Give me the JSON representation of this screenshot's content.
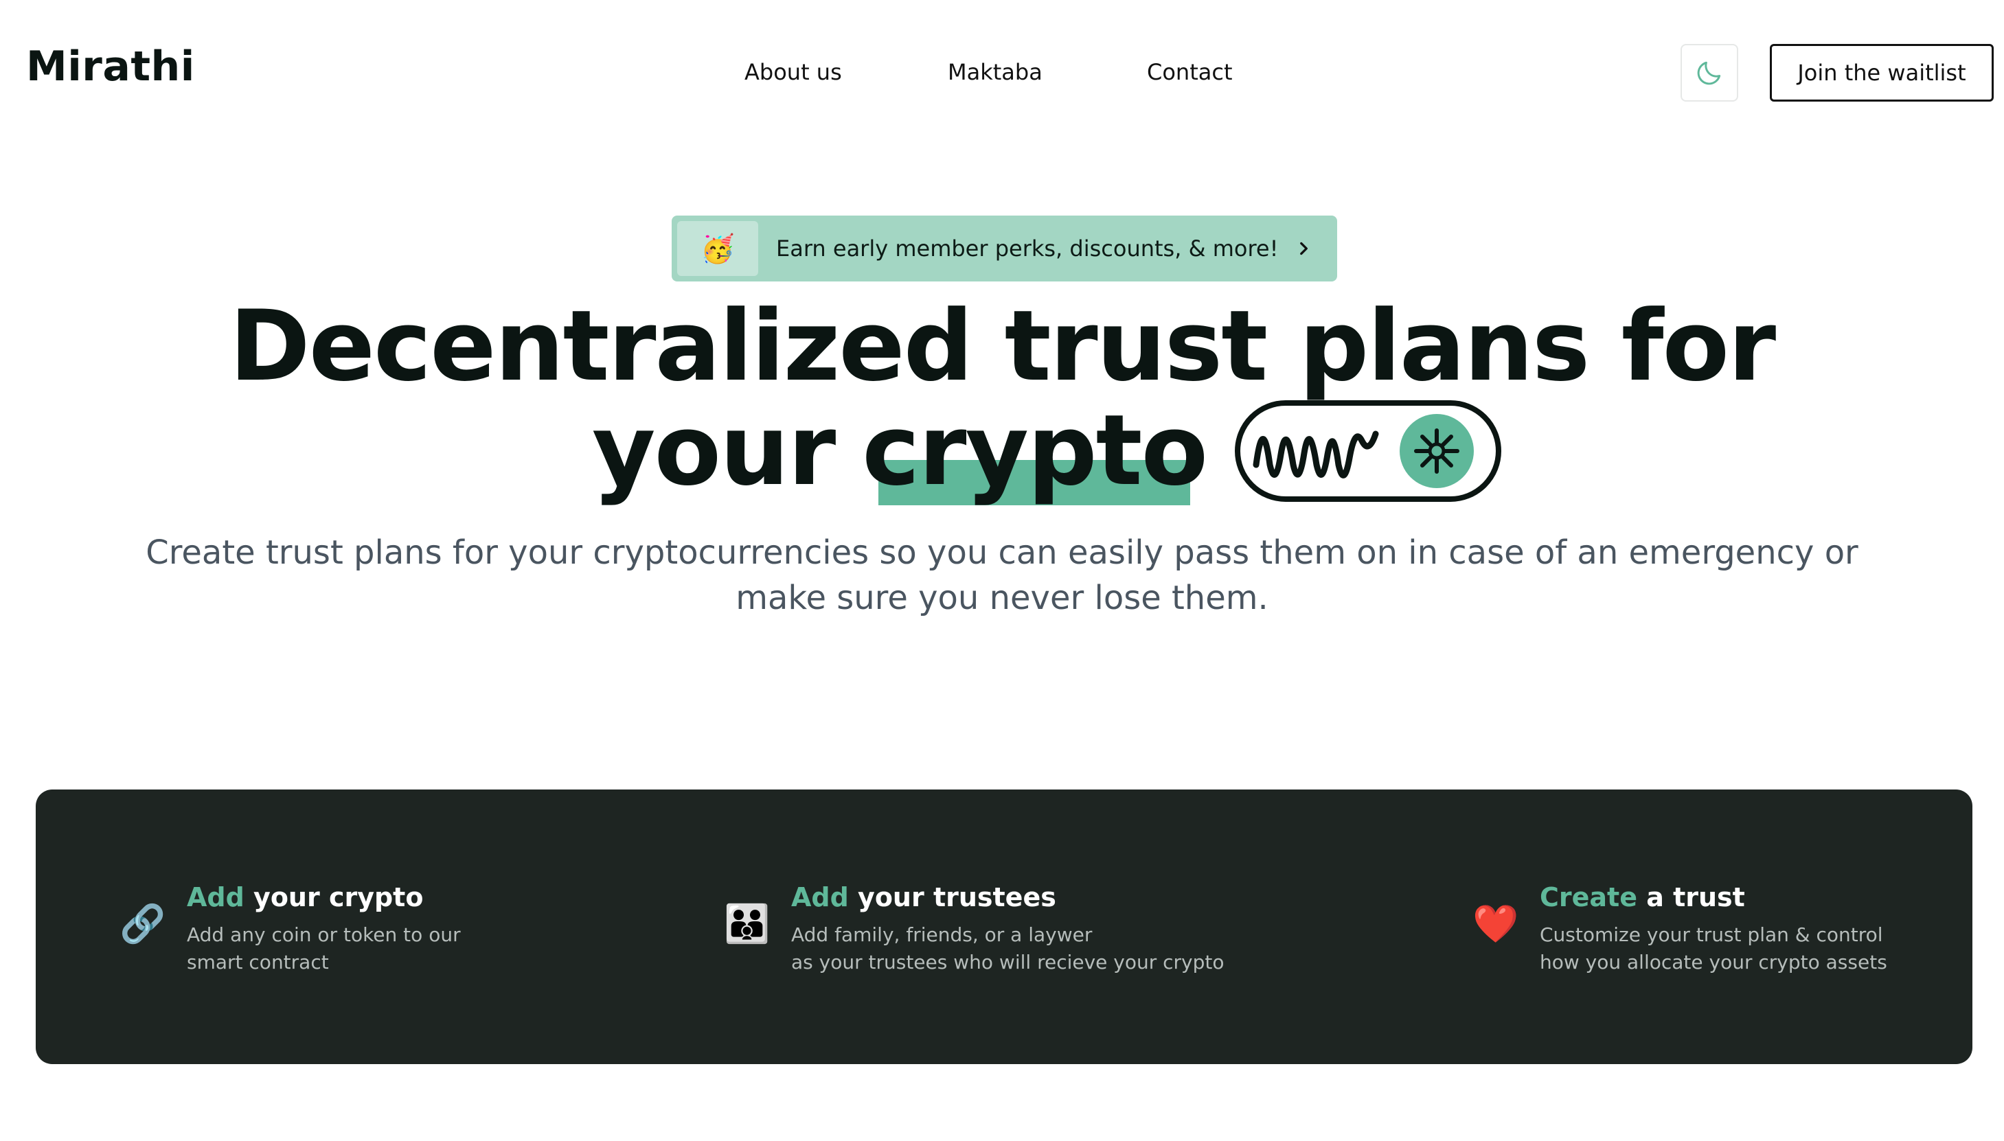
{
  "header": {
    "logo": "Mirathi",
    "nav": [
      {
        "label": "About us"
      },
      {
        "label": "Maktaba"
      },
      {
        "label": "Contact"
      }
    ],
    "theme_toggle_icon": "moon-icon",
    "cta_label": "Join the waitlist"
  },
  "promo": {
    "emoji": "🥳",
    "text": "Earn early member perks, discounts, & more!",
    "icon": "chevron-right-icon"
  },
  "hero": {
    "line1": "Decentralized trust plans for",
    "line2_word1": "your",
    "line2_highlight": "crypto",
    "graphic_icon": "waveform-asterisk-pill-icon",
    "subtitle": "Create trust plans for your cryptocurrencies so you can easily pass them on in case of an emergency or make sure you never lose them."
  },
  "features": [
    {
      "icon": "link-icon",
      "emoji": "🔗",
      "title_accent": "Add",
      "title_rest": " your crypto",
      "desc_line1": "Add any coin or token to our",
      "desc_line2": "smart contract"
    },
    {
      "icon": "family-icon",
      "emoji": "👨‍👨‍👦",
      "title_accent": "Add",
      "title_rest": " your trustees",
      "desc_line1": "Add family, friends, or a laywer",
      "desc_line2": "as your trustees who will recieve your crypto"
    },
    {
      "icon": "heart-icon",
      "emoji": "❤️",
      "title_accent": "Create",
      "title_rest": " a trust",
      "desc_line1": "Customize your trust plan & control",
      "desc_line2": "how you allocate your crypto assets"
    }
  ],
  "colors": {
    "accent": "#5fb89a",
    "banner": "#a3d6c3",
    "panel": "#1e2522",
    "text_dark": "#0b1512",
    "text_muted": "#4a5560"
  }
}
